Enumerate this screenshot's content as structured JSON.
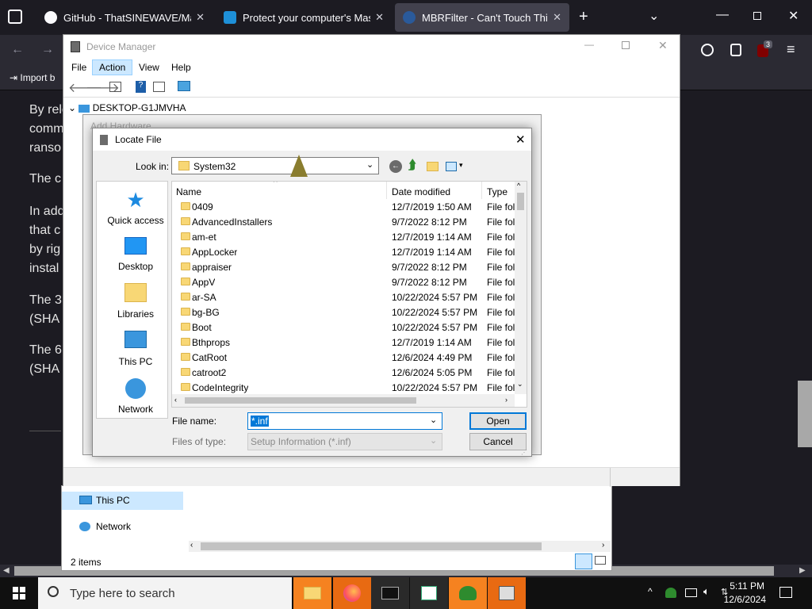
{
  "browser": {
    "tabs": [
      {
        "title": "GitHub - ThatSINEWAVE/Malwa",
        "icon": "github-icon"
      },
      {
        "title": "Protect your computer's Maste",
        "icon": "article-icon"
      },
      {
        "title": "MBRFilter - Can't Touch This!",
        "icon": "page-icon"
      }
    ],
    "bookmarks_import": "Import b",
    "notification_badge": "3"
  },
  "webpage": {
    "paragraph_fragments": [
      "By rele",
      "comm",
      "ranso",
      "The c",
      "In add",
      "that c",
      "by rig",
      "instal",
      "The 3",
      "(SHA",
      "The 6",
      "(SHA"
    ]
  },
  "device_manager": {
    "title": "Device Manager",
    "menu": [
      "File",
      "Action",
      "View",
      "Help"
    ],
    "tree_root": "DESKTOP-G1JMVHA",
    "bg_text": "Add Hardware"
  },
  "explorer_back": {
    "nav_items": [
      "This PC",
      "Network"
    ],
    "status": "2 items"
  },
  "locate_file": {
    "title": "Locate File",
    "look_in_label": "Look in:",
    "look_in_value": "System32",
    "places": [
      "Quick access",
      "Desktop",
      "Libraries",
      "This PC",
      "Network"
    ],
    "columns": [
      "Name",
      "Date modified",
      "Type"
    ],
    "files": [
      {
        "name": "0409",
        "date": "12/7/2019 1:50 AM",
        "type": "File fol"
      },
      {
        "name": "AdvancedInstallers",
        "date": "9/7/2022 8:12 PM",
        "type": "File fol"
      },
      {
        "name": "am-et",
        "date": "12/7/2019 1:14 AM",
        "type": "File fol"
      },
      {
        "name": "AppLocker",
        "date": "12/7/2019 1:14 AM",
        "type": "File fol"
      },
      {
        "name": "appraiser",
        "date": "9/7/2022 8:12 PM",
        "type": "File fol"
      },
      {
        "name": "AppV",
        "date": "9/7/2022 8:12 PM",
        "type": "File fol"
      },
      {
        "name": "ar-SA",
        "date": "10/22/2024 5:57 PM",
        "type": "File fol"
      },
      {
        "name": "bg-BG",
        "date": "10/22/2024 5:57 PM",
        "type": "File fol"
      },
      {
        "name": "Boot",
        "date": "10/22/2024 5:57 PM",
        "type": "File fol"
      },
      {
        "name": "Bthprops",
        "date": "12/7/2019 1:14 AM",
        "type": "File fol"
      },
      {
        "name": "CatRoot",
        "date": "12/6/2024 4:49 PM",
        "type": "File fol"
      },
      {
        "name": "catroot2",
        "date": "12/6/2024 5:05 PM",
        "type": "File fol"
      },
      {
        "name": "CodeIntegrity",
        "date": "10/22/2024 5:57 PM",
        "type": "File fol"
      }
    ],
    "file_name_label": "File name:",
    "file_name_value": "*.inf",
    "files_of_type_label": "Files of type:",
    "files_of_type_value": "Setup Information (*.inf)",
    "open_label": "Open",
    "cancel_label": "Cancel"
  },
  "taskbar": {
    "search_placeholder": "Type here to search",
    "time": "5:11 PM",
    "date": "12/6/2024"
  },
  "colors": {
    "accent": "#0078d7",
    "folder": "#f8d775",
    "dark_bg": "#1c1b22"
  }
}
